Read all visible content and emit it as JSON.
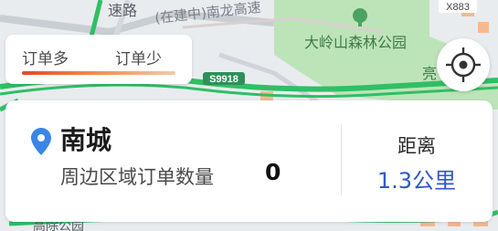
{
  "map": {
    "road_left_vertical": "速路",
    "road_construction": "(在建中)南龙高速",
    "road_badge": "S9918",
    "route_code": "X883",
    "park_label": "大岭山森林公园",
    "edge_label": "亮",
    "bottom_place": "高除公园",
    "colors": {
      "park_green": "#bde4b9",
      "road_green": "#2fbf64",
      "block_orange": "#f6b98f",
      "badge_green": "#2f8f59"
    }
  },
  "legend": {
    "more_label": "订单多",
    "less_label": "订单少",
    "gradient_colors": [
      "#e24a2a",
      "#f08a4b",
      "#f6c9a6"
    ]
  },
  "locate": {
    "icon": "crosshair-icon"
  },
  "info": {
    "area_name": "南城",
    "nearby_orders_label": "周边区域订单数量",
    "nearby_orders_value": "0",
    "distance_label": "距离",
    "distance_value": "1.3公里",
    "pin_color": "#3a86e6"
  }
}
